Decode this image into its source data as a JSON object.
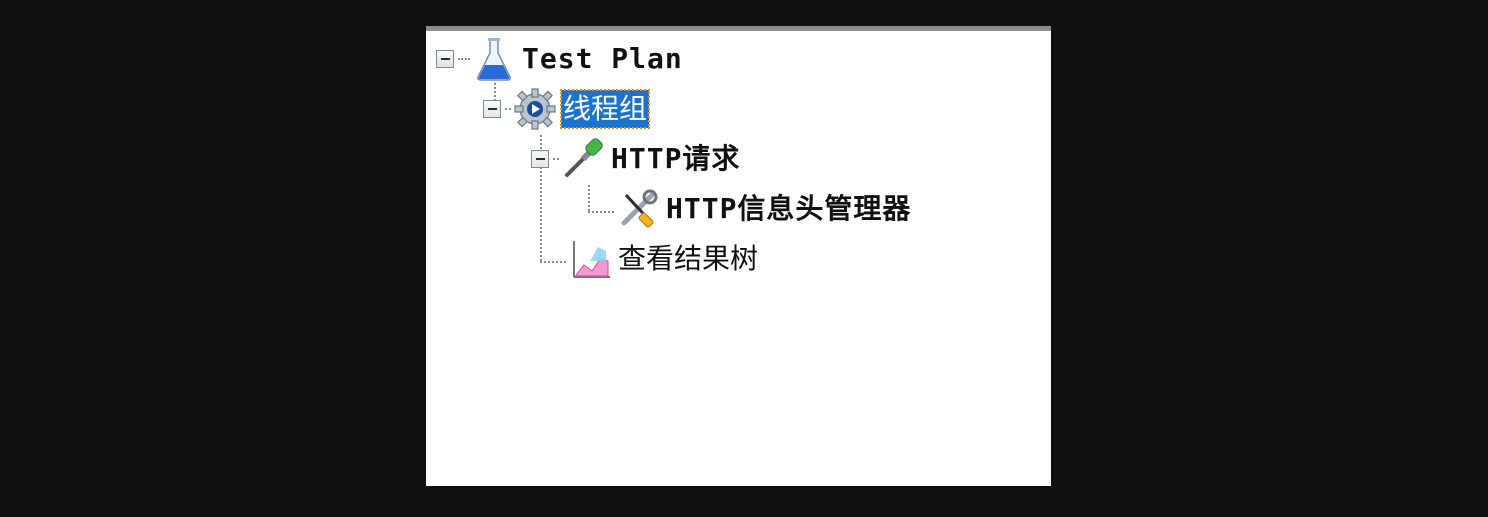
{
  "tree": {
    "nodes": [
      {
        "label": "Test Plan",
        "icon": "flask-icon",
        "expanded": true
      },
      {
        "label": "线程组",
        "icon": "gear-icon",
        "expanded": true,
        "selected": true
      },
      {
        "label": "HTTP请求",
        "icon": "pipette-icon",
        "expanded": true
      },
      {
        "label": "HTTP信息头管理器",
        "icon": "tools-icon"
      },
      {
        "label": "查看结果树",
        "icon": "graph-icon"
      }
    ]
  },
  "colors": {
    "selection_bg": "#1a73d1",
    "selection_focus": "#e09020",
    "background": "#0f0f0f",
    "panel": "#ffffff"
  }
}
